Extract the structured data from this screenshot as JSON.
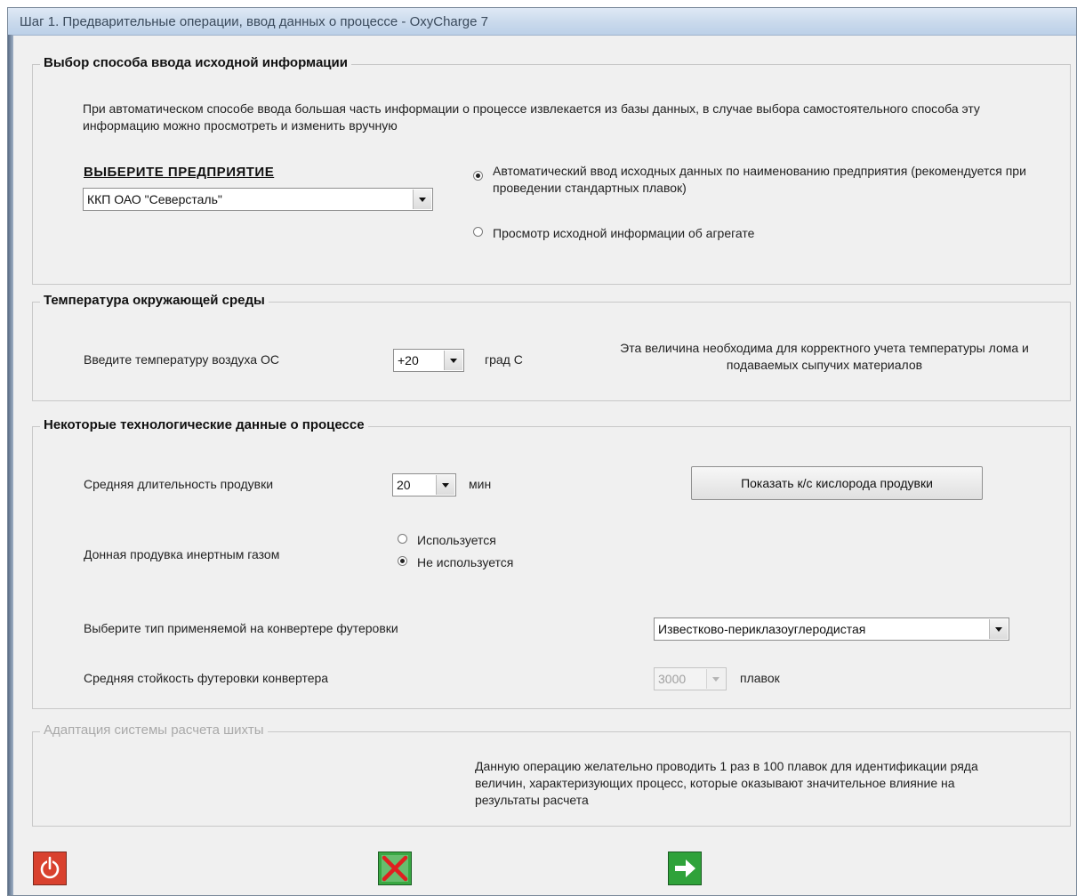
{
  "window": {
    "title": "Шаг 1. Предварительные операции, ввод данных о процессе - OxyCharge 7"
  },
  "input_method": {
    "legend": "Выбор способа ввода исходной информации",
    "description": "При автоматическом способе ввода большая часть информации о процессе извлекается из базы данных, в случае выбора самостоятельного способа эту информацию можно просмотреть и изменить вручную",
    "enterprise_label": "ВЫБЕРИТЕ ПРЕДПРИЯТИЕ",
    "enterprise_value": "ККП ОАО \"Северсталь\"",
    "option_auto": "Автоматический ввод исходных данных по наименованию предприятия (рекомендуется при проведении стандартных плавок)",
    "option_view": "Просмотр исходной информации об агрегате"
  },
  "temperature": {
    "legend": "Температура окружающей среды",
    "label": "Введите температуру воздуха ОС",
    "value": "+20",
    "unit": "град С",
    "note": "Эта величина необходима для корректного учета температуры лома и подаваемых сыпучих материалов"
  },
  "process": {
    "legend": "Некоторые технологические данные о процессе",
    "blow_label": "Средняя длительность продувки",
    "blow_value": "20",
    "blow_unit": "мин",
    "oxygen_button": "Показать к/с кислорода продувки",
    "bottom_label": "Донная продувка инертным газом",
    "bottom_used": "Используется",
    "bottom_not_used": "Не используется",
    "lining_label": "Выберите тип применяемой на конвертере футеровки",
    "lining_value": "Известково-периклазоуглеродистая",
    "durability_label": "Средняя стойкость футеровки конвертера",
    "durability_value": "3000",
    "durability_unit": "плавок"
  },
  "adaptation": {
    "legend": "Адаптация системы расчета шихты",
    "note": "Данную операцию желательно проводить 1 раз в 100 плавок для идентификации ряда величин, характеризующих процесс, которые оказывают значительное влияние на результаты расчета"
  },
  "icons": {
    "exit": "power-icon",
    "cancel": "cancel-icon",
    "next": "arrow-right-icon"
  },
  "colors": {
    "exit_bg": "#d9412e",
    "cancel_bg": "#39a843",
    "cancel_x": "#e02020",
    "next_bg": "#2fa23a"
  }
}
